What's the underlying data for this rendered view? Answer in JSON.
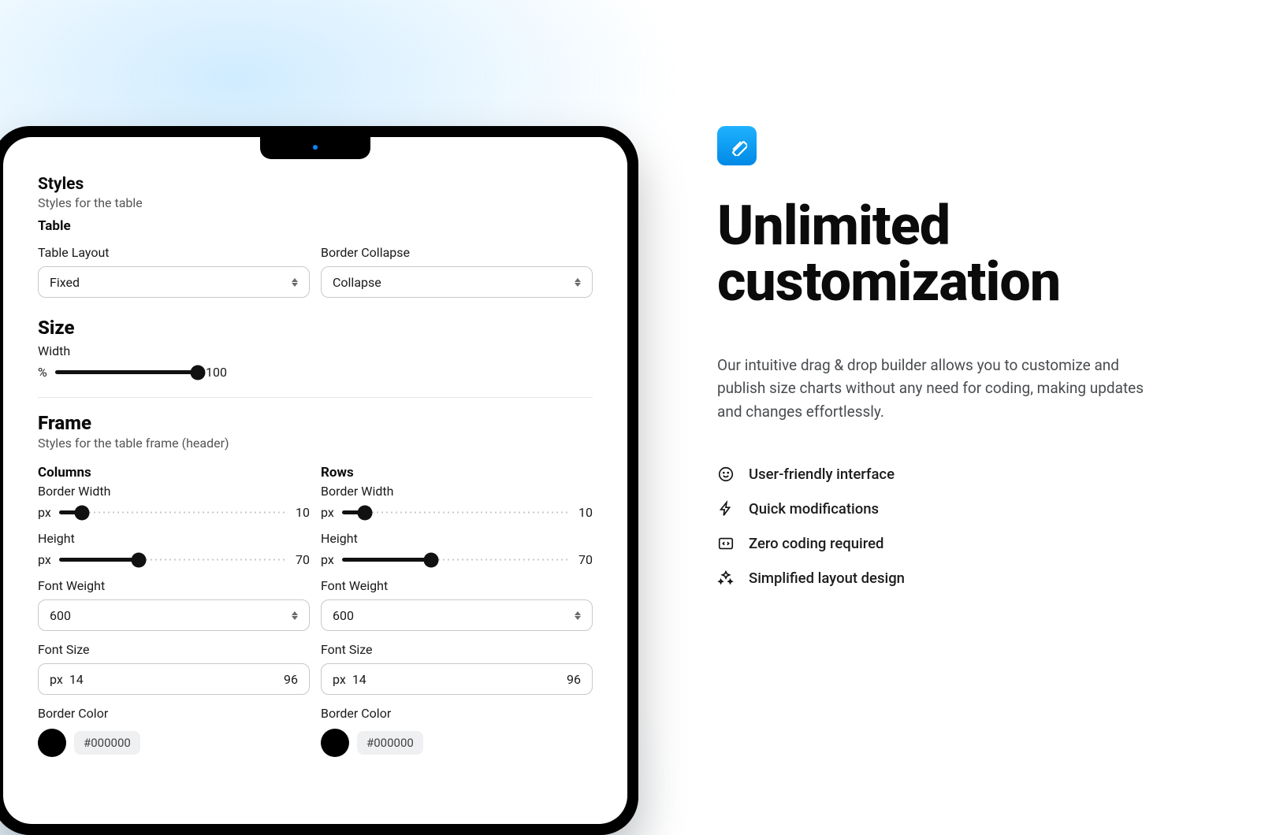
{
  "panel": {
    "styles": {
      "title": "Styles",
      "subtitle": "Styles for the table",
      "table_label": "Table",
      "table_layout_label": "Table Layout",
      "table_layout_value": "Fixed",
      "border_collapse_label": "Border Collapse",
      "border_collapse_value": "Collapse"
    },
    "size": {
      "title": "Size",
      "width_label": "Width",
      "unit": "%",
      "value": "100"
    },
    "frame": {
      "title": "Frame",
      "subtitle": "Styles for the table frame (header)",
      "columns": {
        "title": "Columns",
        "border_width_label": "Border Width",
        "border_width_unit": "px",
        "border_width_value": "10",
        "height_label": "Height",
        "height_unit": "px",
        "height_value": "70",
        "font_weight_label": "Font Weight",
        "font_weight_value": "600",
        "font_size_label": "Font Size",
        "font_size_unit": "px",
        "font_size_left": "14",
        "font_size_right": "96",
        "border_color_label": "Border Color",
        "border_color_value": "#000000"
      },
      "rows": {
        "title": "Rows",
        "border_width_label": "Border Width",
        "border_width_unit": "px",
        "border_width_value": "10",
        "height_label": "Height",
        "height_unit": "px",
        "height_value": "70",
        "font_weight_label": "Font Weight",
        "font_weight_value": "600",
        "font_size_label": "Font Size",
        "font_size_unit": "px",
        "font_size_left": "14",
        "font_size_right": "96",
        "border_color_label": "Border Color",
        "border_color_value": "#000000"
      }
    }
  },
  "hero": {
    "title_line1": "Unlimited",
    "title_line2": "customization",
    "description": "Our intuitive drag & drop builder allows you to customize and publish size charts without any need for coding, making updates and changes effortlessly.",
    "features": [
      "User-friendly interface",
      "Quick modifications",
      "Zero coding required",
      "Simplified layout design"
    ]
  },
  "colors": {
    "accent": "#0a9cf1",
    "black": "#000000"
  }
}
